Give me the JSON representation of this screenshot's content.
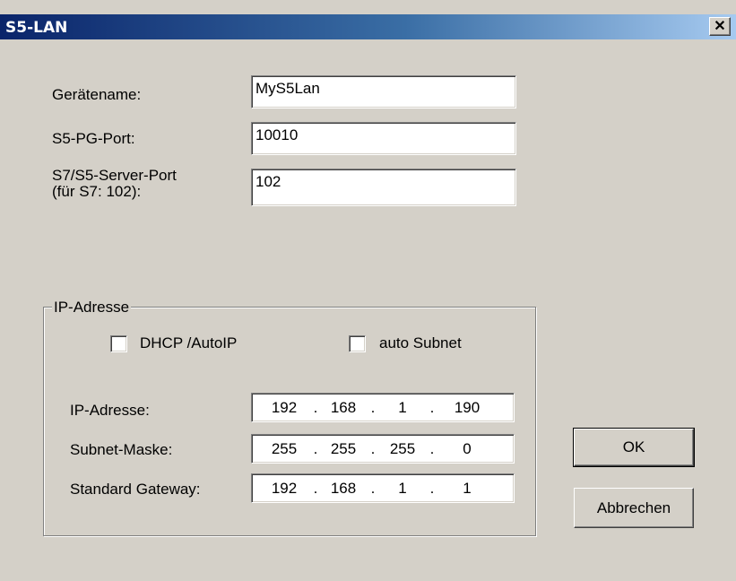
{
  "window": {
    "title": "S5-LAN",
    "close_glyph": "✕",
    "titlebar_colors": [
      "#0a246a",
      "#a6caf0"
    ]
  },
  "fields": {
    "device_name_label": "Gerätename:",
    "device_name_value": "MyS5Lan",
    "pg_port_label": "S5-PG-Port:",
    "pg_port_value": "10010",
    "server_port_label_line1": "S7/S5-Server-Port",
    "server_port_label_line2": "(für S7: 102):",
    "server_port_value": "102"
  },
  "ip_group": {
    "legend": "IP-Adresse",
    "dhcp_label": "DHCP /AutoIP",
    "dhcp_checked": false,
    "auto_subnet_label": "auto Subnet",
    "auto_subnet_checked": false,
    "rows": [
      {
        "label": "IP-Adresse:",
        "octets": [
          "192",
          "168",
          "1",
          "190"
        ]
      },
      {
        "label": "Subnet-Maske:",
        "octets": [
          "255",
          "255",
          "255",
          "0"
        ]
      },
      {
        "label": "Standard Gateway:",
        "octets": [
          "192",
          "168",
          "1",
          "1"
        ]
      }
    ]
  },
  "buttons": {
    "ok": "OK",
    "cancel": "Abbrechen"
  }
}
